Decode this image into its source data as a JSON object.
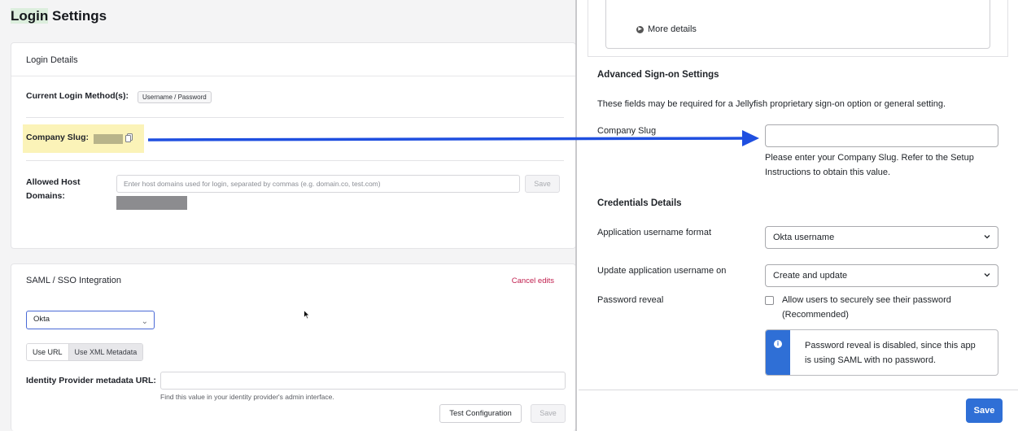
{
  "left": {
    "page_title_a": "Login",
    "page_title_b": " Settings",
    "login_details": {
      "heading": "Login Details",
      "current_method_label": "Current Login Method(s):",
      "current_method_value": "Username / Password",
      "company_slug_label": "Company Slug:",
      "allowed_hosts_label_line1": "Allowed Host",
      "allowed_hosts_label_line2": "Domains:",
      "allowed_hosts_placeholder": "Enter host domains used for login, separated by commas (e.g. domain.co, test.com)",
      "save_label": "Save"
    },
    "saml": {
      "heading": "SAML / SSO Integration",
      "cancel_edits": "Cancel edits",
      "provider_selected": "Okta",
      "tab_url": "Use URL",
      "tab_xml": "Use XML Metadata",
      "idp_url_label": "Identity Provider metadata URL:",
      "idp_url_value": "",
      "helper": "Find this value in your identity provider's admin interface.",
      "test_config": "Test Configuration",
      "save_label": "Save"
    }
  },
  "right": {
    "more_details": "More details",
    "advanced_title": "Advanced Sign-on Settings",
    "advanced_desc": "These fields may be required for a Jellyfish proprietary sign-on option or general setting.",
    "company_slug_label": "Company Slug",
    "company_slug_value": "",
    "company_slug_help_line1": "Please enter your Company Slug. Refer to the Setup",
    "company_slug_help_line2": "Instructions to obtain this value.",
    "credentials_title": "Credentials Details",
    "username_format_label": "Application username format",
    "username_format_value": "Okta username",
    "update_username_label": "Update application username on",
    "update_username_value": "Create and update",
    "password_reveal_label": "Password reveal",
    "password_reveal_option_line1": "Allow users to securely see their password",
    "password_reveal_option_line2": "(Recommended)",
    "password_reveal_checked": false,
    "callout_line1": "Password reveal is disabled, since this app",
    "callout_line2": "is using SAML with no password.",
    "save_label": "Save"
  },
  "colors": {
    "primary": "#2f6fd6",
    "arrow": "#1f4fe0",
    "slug_highlight": "#fbf3b8",
    "cancel": "#c1204f"
  },
  "icons": [
    "copy-icon",
    "chevron-down-icon",
    "info-icon",
    "arrow-annotation",
    "cursor-pointer-icon",
    "more-details-icon"
  ]
}
